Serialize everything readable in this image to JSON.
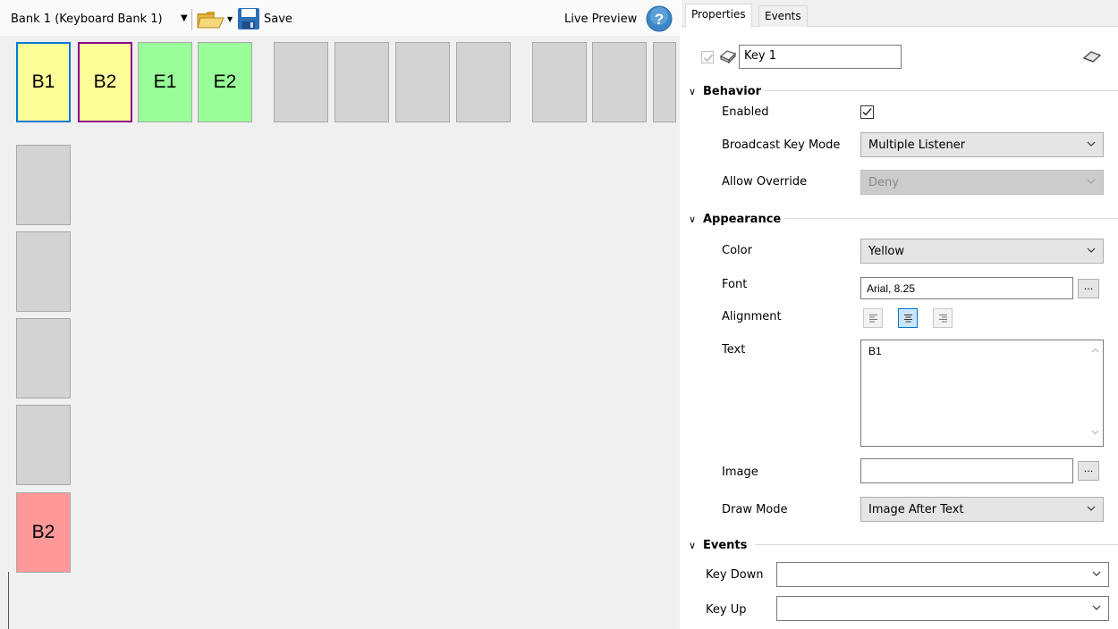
{
  "toolbar": {
    "bank_selector": "Bank 1 (Keyboard Bank 1)",
    "save_label": "Save",
    "live_preview_label": "Live Preview"
  },
  "keys": {
    "top_row": [
      "B1",
      "B2",
      "E1",
      "E2",
      "",
      "",
      "",
      "",
      "",
      "",
      ""
    ],
    "left_column": [
      "",
      "",
      "",
      "",
      "B2"
    ]
  },
  "colors": {
    "key_default": "#d3d3d3",
    "key_yellow": "#ffff99",
    "key_green": "#99ff99",
    "key_red": "#ff9999",
    "selection_blue": "#0078d7",
    "selection_purple": "#8b008b"
  },
  "tabs": {
    "properties": "Properties",
    "events": "Events",
    "active": "Properties"
  },
  "properties": {
    "key_name": "Key 1",
    "behavior": {
      "header": "Behavior",
      "enabled_label": "Enabled",
      "enabled_checked": true,
      "broadcast_label": "Broadcast Key Mode",
      "broadcast_value": "Multiple Listener",
      "override_label": "Allow Override",
      "override_value": "Deny"
    },
    "appearance": {
      "header": "Appearance",
      "color_label": "Color",
      "color_value": "Yellow",
      "font_label": "Font",
      "font_value": "Arial, 8.25",
      "font_button": "...",
      "alignment_label": "Alignment",
      "alignment_value": "center",
      "text_label": "Text",
      "text_value": "B1",
      "image_label": "Image",
      "image_value": "",
      "image_button": "...",
      "draw_mode_label": "Draw Mode",
      "draw_mode_value": "Image After Text"
    },
    "events": {
      "header": "Events",
      "key_down_label": "Key Down",
      "key_down_value": "",
      "key_up_label": "Key Up",
      "key_up_value": ""
    }
  },
  "icons": {
    "bank_dropdown": "caret-down-icon",
    "open": "folder-open-icon",
    "save": "floppy-disk-icon",
    "help": "help-question-icon",
    "key_type": "key-icon",
    "clear": "eraser-icon"
  }
}
